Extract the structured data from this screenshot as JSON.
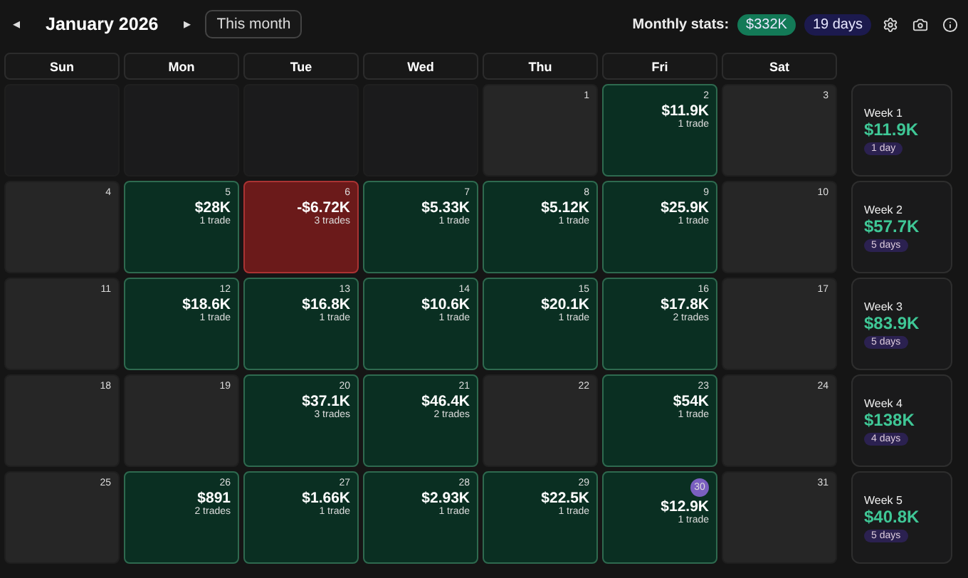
{
  "header": {
    "prev": "◂",
    "month": "January 2026",
    "next": "▸",
    "this_month": "This month",
    "stats_label": "Monthly stats:",
    "stats_pnl": "$332K",
    "stats_days": "19 days"
  },
  "weekdays": [
    "Sun",
    "Mon",
    "Tue",
    "Wed",
    "Thu",
    "Fri",
    "Sat"
  ],
  "weeks": [
    {
      "days": [
        {
          "kind": "empty"
        },
        {
          "kind": "empty"
        },
        {
          "kind": "empty"
        },
        {
          "kind": "empty"
        },
        {
          "kind": "none",
          "date": "1"
        },
        {
          "kind": "profit",
          "date": "2",
          "pnl": "$11.9K",
          "trades": "1 trade"
        },
        {
          "kind": "none",
          "date": "3"
        }
      ],
      "label": "Week 1",
      "pnl": "$11.9K",
      "days_count": "1 day"
    },
    {
      "days": [
        {
          "kind": "none",
          "date": "4"
        },
        {
          "kind": "profit",
          "date": "5",
          "pnl": "$28K",
          "trades": "1 trade"
        },
        {
          "kind": "loss",
          "date": "6",
          "pnl": "-$6.72K",
          "trades": "3 trades"
        },
        {
          "kind": "profit",
          "date": "7",
          "pnl": "$5.33K",
          "trades": "1 trade"
        },
        {
          "kind": "profit",
          "date": "8",
          "pnl": "$5.12K",
          "trades": "1 trade"
        },
        {
          "kind": "profit",
          "date": "9",
          "pnl": "$25.9K",
          "trades": "1 trade"
        },
        {
          "kind": "none",
          "date": "10"
        }
      ],
      "label": "Week 2",
      "pnl": "$57.7K",
      "days_count": "5 days"
    },
    {
      "days": [
        {
          "kind": "none",
          "date": "11"
        },
        {
          "kind": "profit",
          "date": "12",
          "pnl": "$18.6K",
          "trades": "1 trade"
        },
        {
          "kind": "profit",
          "date": "13",
          "pnl": "$16.8K",
          "trades": "1 trade"
        },
        {
          "kind": "profit",
          "date": "14",
          "pnl": "$10.6K",
          "trades": "1 trade"
        },
        {
          "kind": "profit",
          "date": "15",
          "pnl": "$20.1K",
          "trades": "1 trade"
        },
        {
          "kind": "profit",
          "date": "16",
          "pnl": "$17.8K",
          "trades": "2 trades"
        },
        {
          "kind": "none",
          "date": "17"
        }
      ],
      "label": "Week 3",
      "pnl": "$83.9K",
      "days_count": "5 days"
    },
    {
      "days": [
        {
          "kind": "none",
          "date": "18"
        },
        {
          "kind": "none",
          "date": "19"
        },
        {
          "kind": "profit",
          "date": "20",
          "pnl": "$37.1K",
          "trades": "3 trades"
        },
        {
          "kind": "profit",
          "date": "21",
          "pnl": "$46.4K",
          "trades": "2 trades"
        },
        {
          "kind": "none",
          "date": "22"
        },
        {
          "kind": "profit",
          "date": "23",
          "pnl": "$54K",
          "trades": "1 trade"
        },
        {
          "kind": "none",
          "date": "24"
        }
      ],
      "label": "Week 4",
      "pnl": "$138K",
      "days_count": "4 days"
    },
    {
      "days": [
        {
          "kind": "none",
          "date": "25"
        },
        {
          "kind": "profit",
          "date": "26",
          "pnl": "$891",
          "trades": "2 trades"
        },
        {
          "kind": "profit",
          "date": "27",
          "pnl": "$1.66K",
          "trades": "1 trade"
        },
        {
          "kind": "profit",
          "date": "28",
          "pnl": "$2.93K",
          "trades": "1 trade"
        },
        {
          "kind": "profit",
          "date": "29",
          "pnl": "$22.5K",
          "trades": "1 trade"
        },
        {
          "kind": "profit",
          "date": "30",
          "pnl": "$12.9K",
          "trades": "1 trade",
          "selected": true
        },
        {
          "kind": "none",
          "date": "31"
        }
      ],
      "label": "Week 5",
      "pnl": "$40.8K",
      "days_count": "5 days"
    }
  ]
}
